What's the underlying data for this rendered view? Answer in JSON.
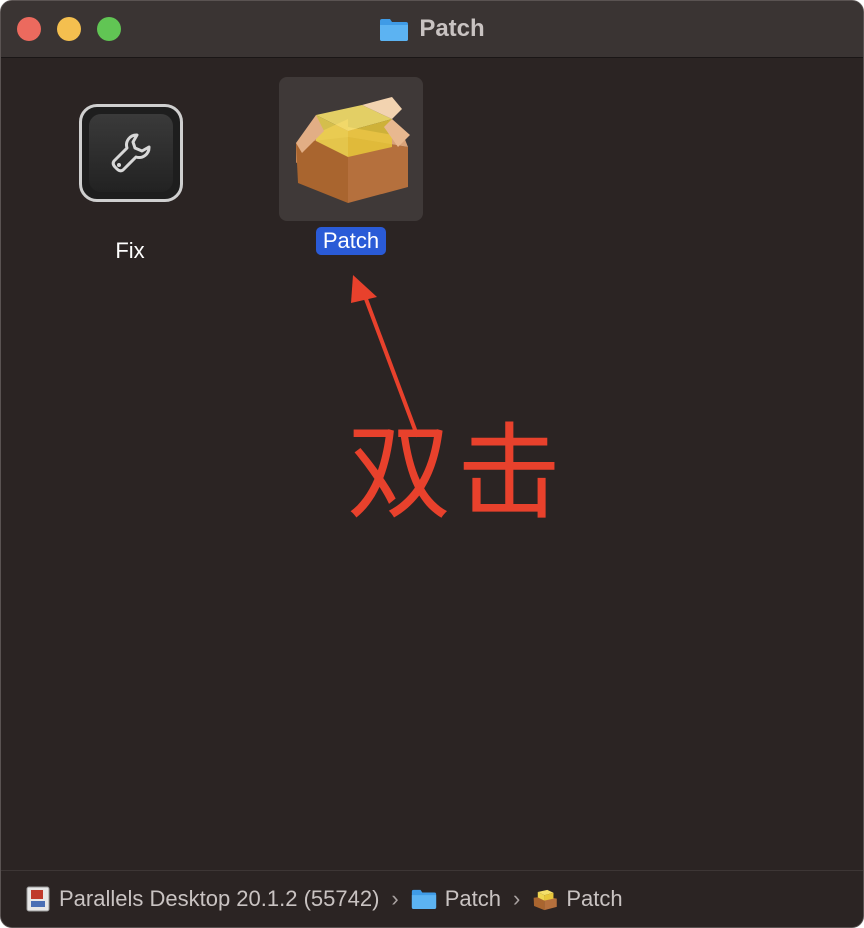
{
  "window": {
    "title": "Patch"
  },
  "files": [
    {
      "name": "Fix",
      "selected": false,
      "icon": "wrench-app-icon"
    },
    {
      "name": "Patch",
      "selected": true,
      "icon": "package-icon"
    }
  ],
  "annotation": {
    "text": "双击",
    "color": "#e8412c"
  },
  "pathbar": {
    "volume": "Parallels Desktop 20.1.2 (55742)",
    "folder": "Patch",
    "file": "Patch",
    "separator": "›"
  },
  "colors": {
    "selection": "#2a5bd7",
    "background": "#2b2423"
  }
}
